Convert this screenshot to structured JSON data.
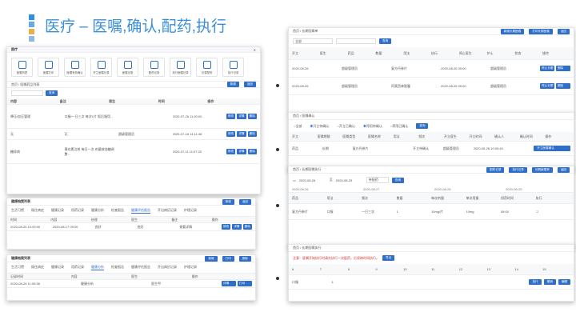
{
  "slide": {
    "title": "医疗 – 医嘱,确认,配药,执行",
    "accent_colors": [
      "#2f8fe0",
      "#e8b04a",
      "#8fb8e8",
      "#5a9be0"
    ]
  },
  "card1": {
    "window_title": "医疗",
    "icons": [
      {
        "label": "医嘱列表",
        "icon": "list-icon"
      },
      {
        "label": "医嘱打印",
        "icon": "print-icon"
      },
      {
        "label": "医嘱有效确认",
        "icon": "shield-icon"
      },
      {
        "label": "开立医嘱记录",
        "icon": "pen-icon"
      },
      {
        "label": "医嘱记录",
        "icon": "doc-icon"
      },
      {
        "label": "配药记录",
        "icon": "pill-icon"
      },
      {
        "label": "执行医嘱记录",
        "icon": "shield-icon"
      },
      {
        "label": "记录配药",
        "icon": "doc-icon"
      },
      {
        "label": "执行记录",
        "icon": "doc-icon"
      }
    ],
    "sub_title": "首页  /  医嘱药品列表",
    "search_btn": "查询",
    "top_btns": [
      "新增",
      "返回"
    ],
    "headers": [
      "内容",
      "备注",
      "医生",
      "时间",
      "操作"
    ],
    "rows": [
      {
        "a": "降压/血压管理",
        "b": "口服/一日三次 每次1片 饭后服用…",
        "c": "",
        "d": "2020-07-26 11:20:00"
      },
      {
        "a": "无",
        "b": "无",
        "c": "超级管理员",
        "d": "2020-07-18 14:11:48"
      },
      {
        "a": "糖尿病",
        "b": "胰岛素注射 每日一次 剂量按血糖调整…",
        "c": "",
        "d": "2020-07-11 11:07:20"
      }
    ],
    "row_actions": [
      "修改",
      "详情",
      "删除"
    ]
  },
  "card2": {
    "bar": "健康档案列表",
    "tabs": [
      "生活习惯",
      "既往病史",
      "健康记录",
      "用药记录",
      "健康分析",
      "检查报告",
      "健康评估报告",
      "开出病历记录",
      "护理记录"
    ],
    "headers": [
      "时间",
      "内容",
      "处理",
      "医生",
      "备注",
      "操作"
    ],
    "row": {
      "a": "2020-08-26 10:09:00",
      "b": "2020-08-17 09:00",
      "c": "良好",
      "d": "良好",
      "e": "查看详情"
    },
    "buttons": [
      "新增",
      "返回"
    ]
  },
  "card3": {
    "bar": "健康档案列表",
    "tabs": [
      "生活习惯",
      "既往病史",
      "健康记录",
      "用药记录",
      "健康分析",
      "检查报告",
      "健康评估报告",
      "开出病历记录",
      "护理记录"
    ],
    "headers": [
      "记录时间",
      "内容",
      "医生",
      "操作"
    ],
    "row": {
      "a": "2020-08-26 11:09:38",
      "b": "健康分析",
      "c": "医生甲"
    },
    "buttons": [
      "新增",
      "打印",
      "删除"
    ]
  },
  "card4": {
    "crumb": "首页  /  长期医嘱单",
    "btns": [
      "新增长期医嘱",
      "打印长期医嘱",
      "返回"
    ],
    "select": "全部",
    "search_btn": "查询",
    "headers": [
      "开立",
      "医生",
      "药品",
      "数量",
      "用法",
      "执行",
      "停止医生",
      "护士",
      "状态",
      "操作"
    ],
    "rows": [
      {
        "a": "2020-08-26",
        "b": "超级管理员",
        "c": "复方丹参片",
        "d": "2020-08-26 09:00",
        "e": "超级管理员"
      },
      {
        "a": "2020-08-26",
        "b": "超级管理员",
        "c": "阿莫西林胶囊",
        "d": "2020-08-26 09:00",
        "e": "超级管理员"
      }
    ]
  },
  "card5": {
    "crumb": "首页  /  医嘱确认",
    "filters": [
      "全部",
      "开立待确认",
      "开立已确认",
      "停用待确认",
      "停用已确认"
    ],
    "search_btn": "查询",
    "headers": [
      "开立",
      "医嘱期限",
      "医嘱类型",
      "医嘱名称",
      "用法",
      "频次",
      "开立医生",
      "开立时间",
      "确认人",
      "确认时间",
      "操作"
    ],
    "row": {
      "a": "药品",
      "b": "长期",
      "c": "复方丹参片",
      "d": "开立待确认",
      "e": "超级管理员",
      "f": "2020-08-26 10:09:40"
    },
    "row_btn": "开立医嘱确认"
  },
  "card6": {
    "crumb": "首页  /  长期医嘱执行",
    "btns": [
      "配药记录",
      "执行记录",
      "长期医嘱单",
      "返回"
    ],
    "date_from": "2020-08-26",
    "date_to": "2020-08-29",
    "select": "待配药",
    "search_btn": "查询",
    "dates": [
      "2020-08-26",
      "2020-08-27",
      "2020-08-28",
      "2020-08-29"
    ],
    "headers": [
      "药品",
      "用法",
      "频次",
      "数量",
      "每次剂量",
      "单次用量",
      "用药时间",
      "执行"
    ],
    "row": {
      "a": "复方丹参片",
      "b": "口服",
      "c": "一日三次",
      "d": "1",
      "e": "10mg/片",
      "f": "10mg",
      "g": "08:00"
    }
  },
  "card7": {
    "crumb": "首页  /  长期医嘱执行",
    "note": "注意：医嘱开始执行时请先执行一次配药，后续按时间执行。",
    "note_btn": "导出",
    "nums": [
      "6",
      "7",
      "8",
      "9",
      "10",
      "11",
      "12",
      "13",
      "14",
      "15"
    ],
    "label": "口服",
    "val": "4",
    "btns": [
      "执行",
      "撤销",
      "编辑"
    ]
  }
}
